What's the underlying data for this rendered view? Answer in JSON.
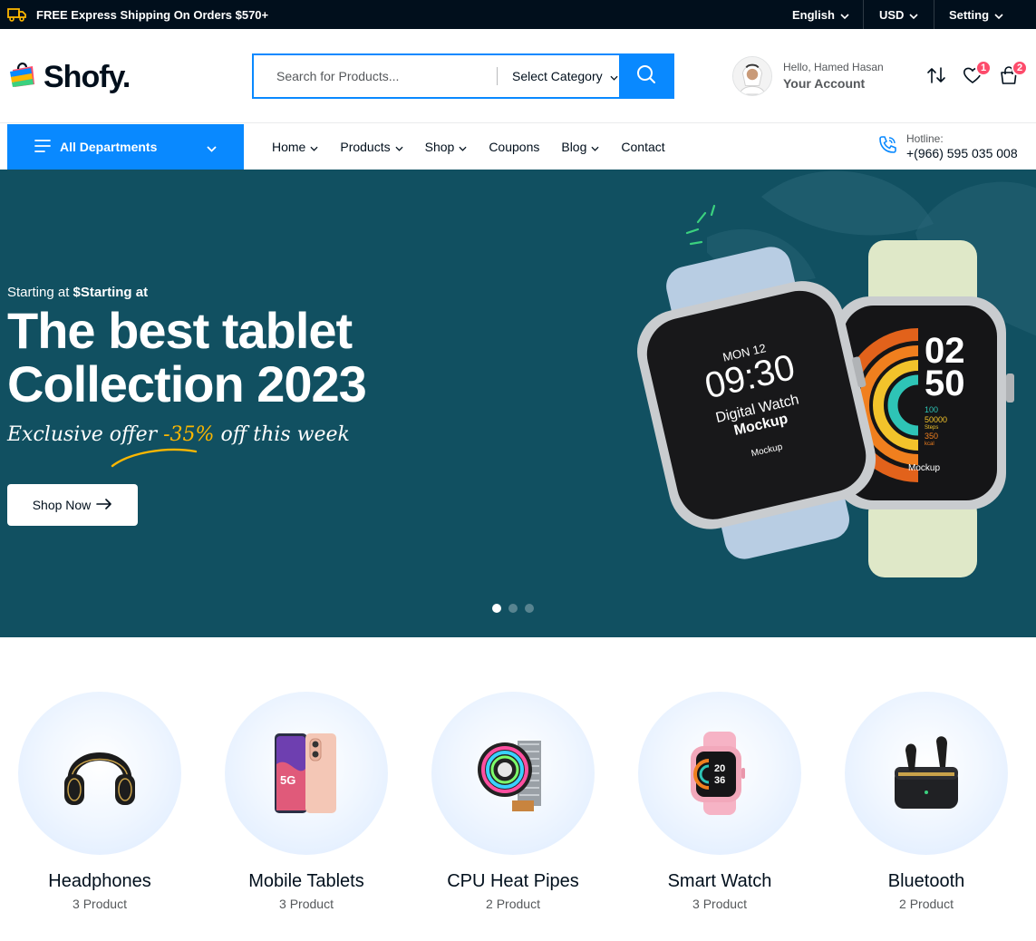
{
  "topbar": {
    "shipping_text": "FREE Express Shipping On Orders $570+",
    "language": "English",
    "currency": "USD",
    "setting": "Setting"
  },
  "header": {
    "logo": "Shofy.",
    "search_placeholder": "Search for Products...",
    "category_select": "Select Category",
    "account_greeting": "Hello, Hamed Hasan",
    "account_label": "Your Account",
    "wishlist_count": "1",
    "cart_count": "2"
  },
  "nav": {
    "departments": "All Departments",
    "items": [
      {
        "label": "Home",
        "dropdown": true
      },
      {
        "label": "Products",
        "dropdown": true
      },
      {
        "label": "Shop",
        "dropdown": true
      },
      {
        "label": "Coupons",
        "dropdown": false
      },
      {
        "label": "Blog",
        "dropdown": true
      },
      {
        "label": "Contact",
        "dropdown": false
      }
    ],
    "hotline_label": "Hotline:",
    "hotline_number": "+(966) 595 035 008"
  },
  "hero": {
    "subtitle_prefix": "Starting at ",
    "subtitle_price": "$Starting at",
    "title_line1": "The best tablet",
    "title_line2": "Collection 2023",
    "offer_prefix": "Exclusive offer ",
    "offer_percent": "-35%",
    "offer_suffix": " off this week",
    "button": "Shop Now",
    "watch_left": {
      "day": "MON 12",
      "time": "09:30",
      "line1": "Digital Watch",
      "line2": "Mockup",
      "brand": "Mockup"
    },
    "watch_right": {
      "hour": "02",
      "minute": "50",
      "stat1": "100",
      "stat2": "50000",
      "stat2_label": "Steps",
      "stat3": "350",
      "stat3_label": "kcal",
      "brand": "Mockup"
    },
    "slides": 3,
    "active_slide": 1
  },
  "categories": [
    {
      "name": "Headphones",
      "count": "3 Product",
      "icon": "headphones-icon"
    },
    {
      "name": "Mobile Tablets",
      "count": "3 Product",
      "icon": "phone-icon"
    },
    {
      "name": "CPU Heat Pipes",
      "count": "2 Product",
      "icon": "cpu-cooler-icon"
    },
    {
      "name": "Smart Watch",
      "count": "3 Product",
      "icon": "smartwatch-icon"
    },
    {
      "name": "Bluetooth",
      "count": "2 Product",
      "icon": "earbuds-icon"
    }
  ],
  "colors": {
    "primary": "#0989ff",
    "topbar": "#010f1c",
    "hero_bg": "#115061",
    "accent": "#fcb700",
    "badge": "#fd4b6b"
  }
}
